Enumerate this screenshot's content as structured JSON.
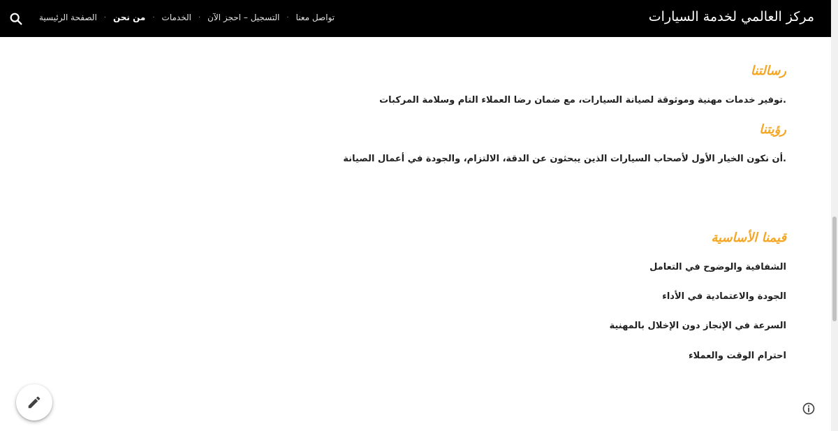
{
  "header": {
    "site_title": "مركز العالمي لخدمة السيارات",
    "nav": [
      {
        "label": "الصفحة الرئيسية",
        "active": false
      },
      {
        "label": "من نحن",
        "active": true
      },
      {
        "label": "الخدمات",
        "active": false
      },
      {
        "label": "التسجيل – احجز الآن",
        "active": false
      },
      {
        "label": "تواصل معنا",
        "active": false
      }
    ],
    "nav_separator": "·",
    "search_icon": "search-icon"
  },
  "sections": {
    "mission": {
      "heading": "رسالتنا",
      "text": ".توفير خدمات مهنية وموثوقة لصيانة السيارات، مع ضمان رضا العملاء التام وسلامة المركبات"
    },
    "vision": {
      "heading": "رؤيتنا",
      "text": ".أن نكون الخيار الأول لأصحاب السيارات الذين يبحثون عن الدقة، الالتزام، والجودة في أعمال الصيانة"
    },
    "values": {
      "heading": "قيمنا الأساسية",
      "items": [
        "الشفافية والوضوح في التعامل",
        "الجودة والاعتمادية في الأداء",
        "السرعة في الإنجاز دون الإخلال بالمهنية",
        "احترام الوقت والعملاء"
      ]
    }
  },
  "fab": {
    "icon": "pencil-icon"
  },
  "info": {
    "icon": "info-icon"
  },
  "colors": {
    "header_bg": "#000000",
    "accent": "#f5a623",
    "text": "#212121"
  }
}
